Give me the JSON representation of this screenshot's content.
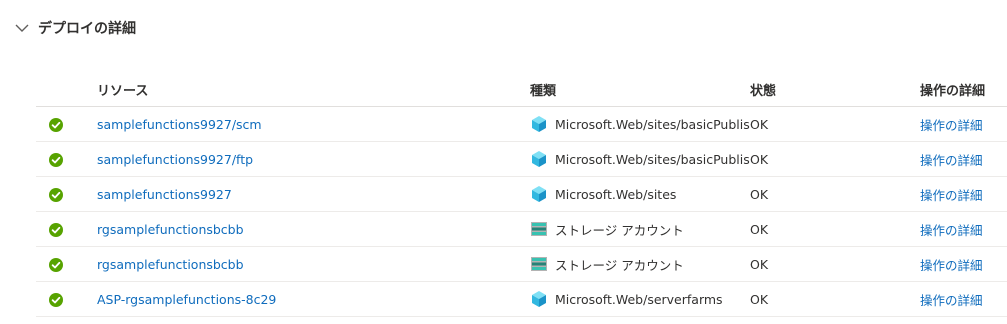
{
  "section": {
    "title": "デプロイの詳細",
    "icon": "chevron-down-icon"
  },
  "table": {
    "headers": {
      "resource": "リソース",
      "type": "種類",
      "state": "状態",
      "operation": "操作の詳細"
    },
    "rows": [
      {
        "status_icon": "success-check-icon",
        "resource": "samplefunctions9927/scm",
        "type_icon": "app-service-cube-icon",
        "type": "Microsoft.Web/sites/basicPublis",
        "state": "OK",
        "operation": "操作の詳細"
      },
      {
        "status_icon": "success-check-icon",
        "resource": "samplefunctions9927/ftp",
        "type_icon": "app-service-cube-icon",
        "type": "Microsoft.Web/sites/basicPublis",
        "state": "OK",
        "operation": "操作の詳細"
      },
      {
        "status_icon": "success-check-icon",
        "resource": "samplefunctions9927",
        "type_icon": "app-service-cube-icon",
        "type": "Microsoft.Web/sites",
        "state": "OK",
        "operation": "操作の詳細"
      },
      {
        "status_icon": "success-check-icon",
        "resource": "rgsamplefunctionsbcbb",
        "type_icon": "storage-account-icon",
        "type": "ストレージ アカウント",
        "state": "OK",
        "operation": "操作の詳細"
      },
      {
        "status_icon": "success-check-icon",
        "resource": "rgsamplefunctionsbcbb",
        "type_icon": "storage-account-icon",
        "type": "ストレージ アカウント",
        "state": "OK",
        "operation": "操作の詳細"
      },
      {
        "status_icon": "success-check-icon",
        "resource": "ASP-rgsamplefunctions-8c29",
        "type_icon": "app-service-cube-icon",
        "type": "Microsoft.Web/serverfarms",
        "state": "OK",
        "operation": "操作の詳細"
      }
    ]
  },
  "colors": {
    "link": "#0f6cbd",
    "success": "#57a300",
    "text": "#323130",
    "border": "#edebe9"
  }
}
